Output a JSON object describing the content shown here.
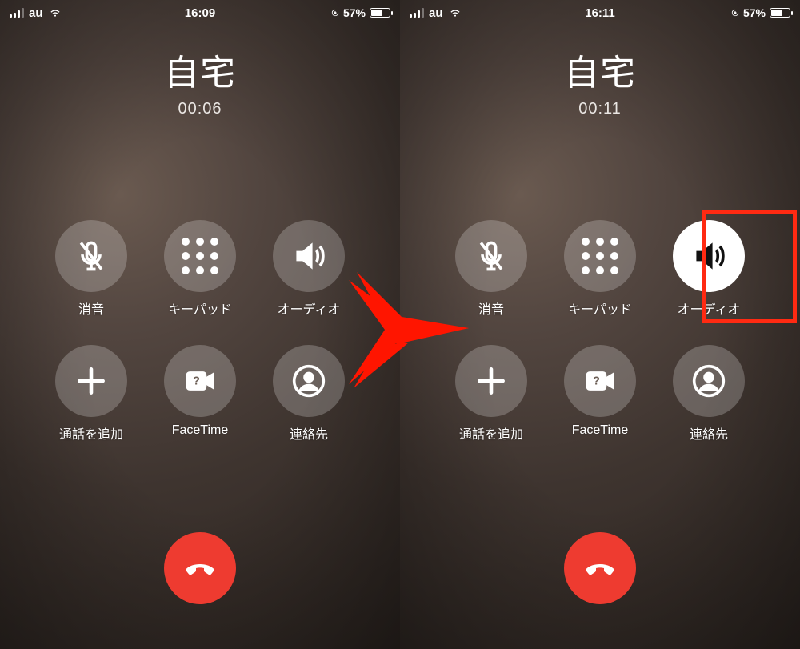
{
  "left": {
    "status": {
      "carrier": "au",
      "time": "16:09",
      "battery_pct": "57%"
    },
    "header": {
      "name": "自宅",
      "duration": "00:06"
    },
    "buttons": {
      "mute": {
        "label": "消音"
      },
      "keypad": {
        "label": "キーパッド"
      },
      "audio": {
        "label": "オーディオ",
        "active": false
      },
      "add_call": {
        "label": "通話を追加"
      },
      "facetime": {
        "label": "FaceTime"
      },
      "contacts": {
        "label": "連絡先"
      }
    }
  },
  "right": {
    "status": {
      "carrier": "au",
      "time": "16:11",
      "battery_pct": "57%"
    },
    "header": {
      "name": "自宅",
      "duration": "00:11"
    },
    "buttons": {
      "mute": {
        "label": "消音"
      },
      "keypad": {
        "label": "キーパッド"
      },
      "audio": {
        "label": "オーディオ",
        "active": true
      },
      "add_call": {
        "label": "通話を追加"
      },
      "facetime": {
        "label": "FaceTime"
      },
      "contacts": {
        "label": "連絡先"
      }
    }
  },
  "highlight": {
    "screen": "right",
    "target": "audio-button"
  }
}
